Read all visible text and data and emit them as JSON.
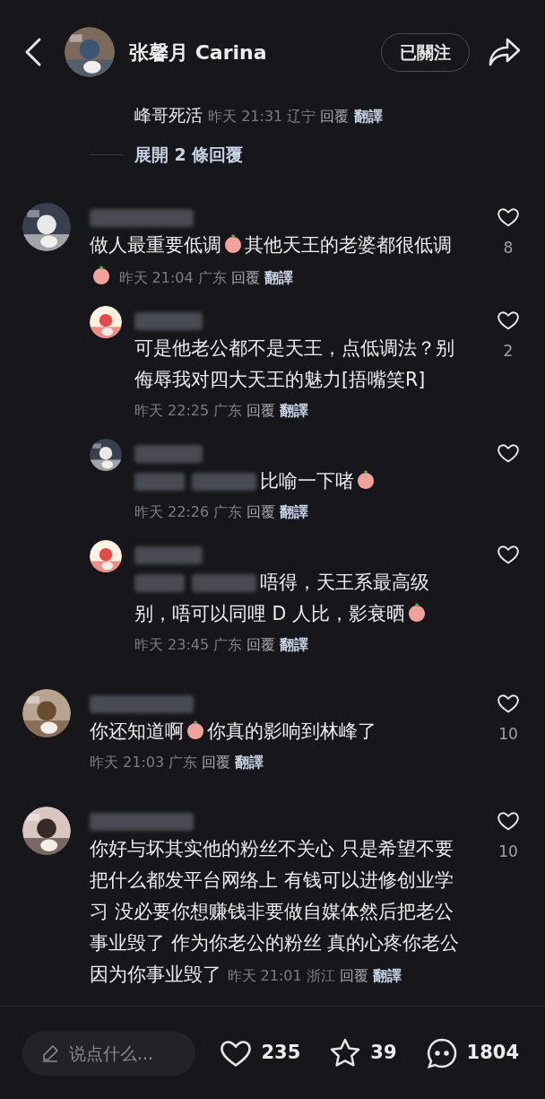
{
  "header": {
    "name": "张馨月 Carina",
    "follow_button": "已關注"
  },
  "thread_tail": {
    "text": "峰哥死活",
    "meta": {
      "time": "昨天 21:31",
      "location": "辽宁",
      "reply": "回覆",
      "translate": "翻譯"
    }
  },
  "expand": {
    "label": "展開 2 條回覆"
  },
  "comments": [
    {
      "body": [
        {
          "kind": "text",
          "text": "做人最重要低调"
        },
        {
          "kind": "emoji"
        },
        {
          "kind": "text",
          "text": "其他天王的老婆都很低调"
        },
        {
          "kind": "emoji"
        }
      ],
      "meta_inline": true,
      "meta": {
        "time": "昨天 21:04",
        "location": "广东",
        "reply": "回覆",
        "translate": "翻譯"
      },
      "likes": "8",
      "replies": [
        {
          "body": [
            {
              "kind": "text",
              "text": "可是他老公都不是天王，点低调法？别侮辱我对四大天王的魅力[捂嘴笑R]"
            }
          ],
          "meta_inline": false,
          "meta": {
            "time": "昨天 22:25",
            "location": "广东",
            "reply": "回覆",
            "translate": "翻譯"
          },
          "likes": "2"
        },
        {
          "body": [
            {
              "kind": "blur"
            },
            {
              "kind": "text",
              "text": "比喻一下啫"
            },
            {
              "kind": "emoji"
            }
          ],
          "meta_inline": false,
          "meta": {
            "time": "昨天 22:26",
            "location": "广东",
            "reply": "回覆",
            "translate": "翻譯"
          }
        },
        {
          "body": [
            {
              "kind": "blur"
            },
            {
              "kind": "text",
              "text": "唔得，天王系最高级"
            },
            {
              "kind": "newline"
            },
            {
              "kind": "text",
              "text": "别，唔可以同哩 D 人比，影衰晒"
            },
            {
              "kind": "emoji"
            }
          ],
          "meta_inline": false,
          "meta": {
            "time": "昨天 23:45",
            "location": "广东",
            "reply": "回覆",
            "translate": "翻譯"
          }
        }
      ]
    },
    {
      "body": [
        {
          "kind": "text",
          "text": "你还知道啊"
        },
        {
          "kind": "emoji"
        },
        {
          "kind": "text",
          "text": "你真的影响到林峰了"
        }
      ],
      "meta_inline": false,
      "meta": {
        "time": "昨天 21:03",
        "location": "广东",
        "reply": "回覆",
        "translate": "翻譯"
      },
      "likes": "10"
    },
    {
      "body": [
        {
          "kind": "text",
          "text": "你好与坏其实他的粉丝不关心 只是希望不要把什么都发平台网络上 有钱可以进修创业学习 没必要你想赚钱非要做自媒体然后把老公事业毁了 作为你老公的粉丝 真的心疼你老公"
        },
        {
          "kind": "newline"
        },
        {
          "kind": "text",
          "text": "因为你事业毁了"
        }
      ],
      "meta_inline": true,
      "meta": {
        "time": "昨天 21:01",
        "location": "浙江",
        "reply": "回覆",
        "translate": "翻譯"
      },
      "likes": "10"
    }
  ],
  "bottom_bar": {
    "placeholder": "说点什么...",
    "likes": "235",
    "stars": "39",
    "comments": "1804"
  }
}
